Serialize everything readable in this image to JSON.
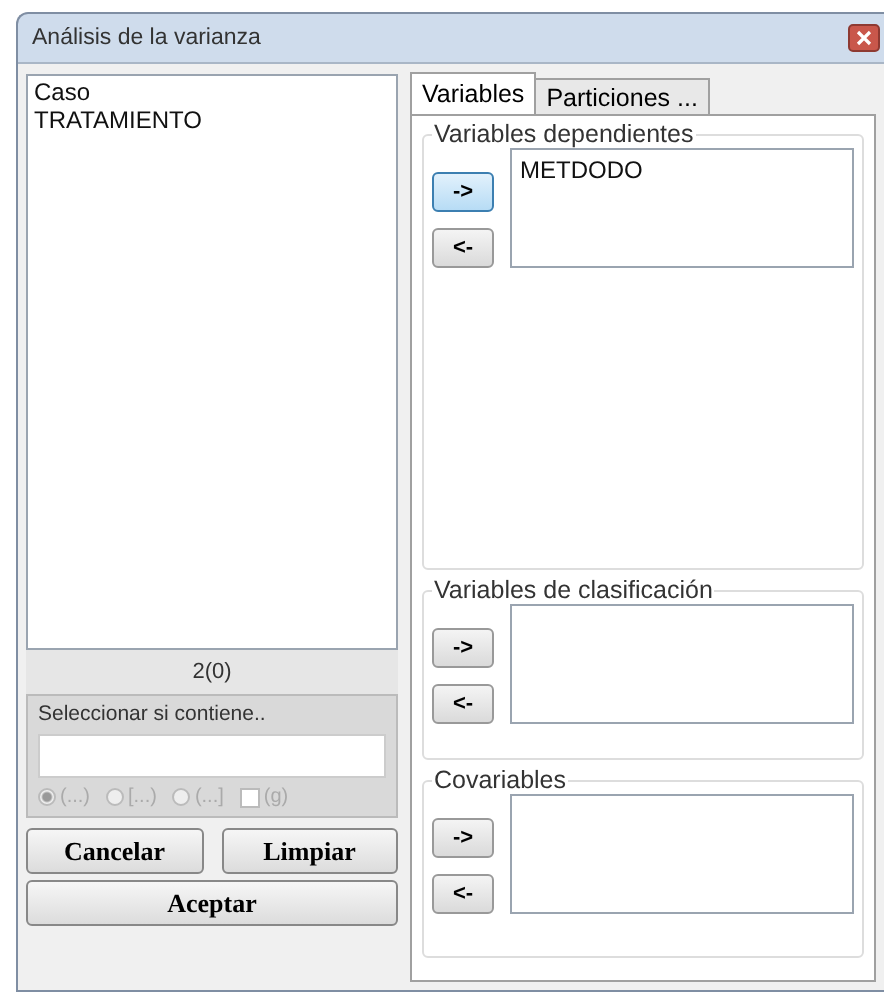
{
  "window": {
    "title": "Análisis de la varianza"
  },
  "variables_list": {
    "items": [
      "Caso",
      "TRATAMIENTO"
    ],
    "count": "2(0)"
  },
  "filter": {
    "label": "Seleccionar si contiene..",
    "options": [
      {
        "kind": "radio",
        "label": "(...)",
        "selected": true
      },
      {
        "kind": "radio",
        "label": "[...)",
        "selected": false
      },
      {
        "kind": "radio",
        "label": "(...]",
        "selected": false
      },
      {
        "kind": "checkbox",
        "label": "(g)",
        "checked": false
      }
    ],
    "disabled": true
  },
  "buttons": {
    "cancel": "Cancelar",
    "clear": "Limpiar",
    "accept": "Aceptar"
  },
  "tabs": [
    {
      "label": "Variables",
      "selected": true
    },
    {
      "label": "Particiones ...",
      "selected": false
    }
  ],
  "groups": [
    {
      "title": "Variables dependientes",
      "add": {
        "label": "->",
        "focused": true
      },
      "remove": {
        "label": "<-",
        "focused": false
      },
      "items": [
        "METDODO"
      ]
    },
    {
      "title": "Variables de clasificación",
      "add": {
        "label": "->",
        "focused": false
      },
      "remove": {
        "label": "<-",
        "focused": false
      }
    },
    {
      "title": "Covariables",
      "add": {
        "label": "->",
        "focused": false
      },
      "remove": {
        "label": "<-",
        "focused": false
      }
    }
  ]
}
